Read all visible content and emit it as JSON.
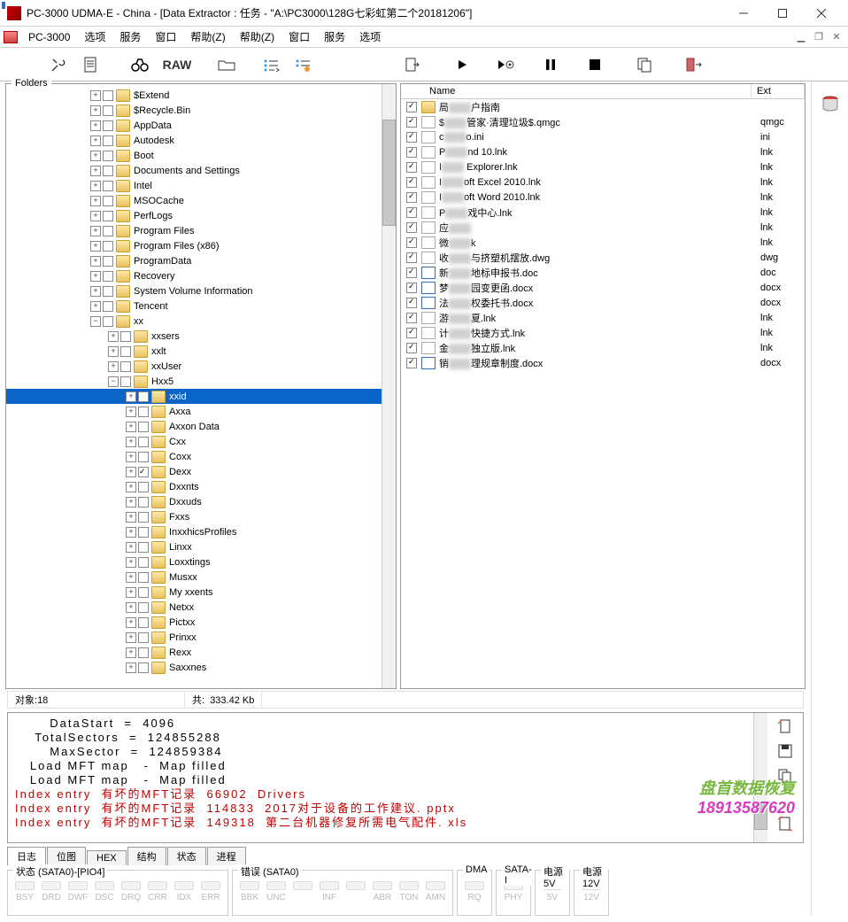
{
  "title": "PC-3000 UDMA-E - China - [Data Extractor : 任务 - \"A:\\PC3000\\128G七彩虹第二个20181206\"]",
  "app_name": "PC-3000",
  "menus": [
    "选项",
    "服务",
    "窗口",
    "帮助(Z)"
  ],
  "raw_label": "RAW",
  "folders_label": "Folders",
  "file_cols": {
    "name": "Name",
    "ext": "Ext"
  },
  "tree": [
    {
      "ind": 95,
      "exp": "+",
      "chk": false,
      "label": "$Extend"
    },
    {
      "ind": 95,
      "exp": "+",
      "chk": false,
      "label": "$Recycle.Bin"
    },
    {
      "ind": 95,
      "exp": "+",
      "chk": false,
      "label": "AppData"
    },
    {
      "ind": 95,
      "exp": "+",
      "chk": false,
      "label": "Autodesk"
    },
    {
      "ind": 95,
      "exp": "+",
      "chk": false,
      "label": "Boot"
    },
    {
      "ind": 95,
      "exp": "+",
      "chk": false,
      "label": "Documents and Settings"
    },
    {
      "ind": 95,
      "exp": "+",
      "chk": false,
      "label": "Intel"
    },
    {
      "ind": 95,
      "exp": "+",
      "chk": false,
      "label": "MSOCache"
    },
    {
      "ind": 95,
      "exp": "+",
      "chk": false,
      "label": "PerfLogs"
    },
    {
      "ind": 95,
      "exp": "+",
      "chk": false,
      "label": "Program Files"
    },
    {
      "ind": 95,
      "exp": "+",
      "chk": false,
      "label": "Program Files (x86)"
    },
    {
      "ind": 95,
      "exp": "+",
      "chk": false,
      "label": "ProgramData"
    },
    {
      "ind": 95,
      "exp": "+",
      "chk": false,
      "label": "Recovery"
    },
    {
      "ind": 95,
      "exp": "+",
      "chk": false,
      "label": "System Volume Information"
    },
    {
      "ind": 95,
      "exp": "+",
      "chk": false,
      "label": "Tencent"
    },
    {
      "ind": 95,
      "exp": "-",
      "chk": false,
      "label": "",
      "blur": 15
    },
    {
      "ind": 115,
      "exp": "+",
      "chk": false,
      "label": "sers",
      "blur": 20
    },
    {
      "ind": 115,
      "exp": "+",
      "chk": false,
      "label": "lt",
      "blur": 30
    },
    {
      "ind": 115,
      "exp": "+",
      "chk": false,
      "label": "User",
      "blur": 25
    },
    {
      "ind": 115,
      "exp": "-",
      "chk": false,
      "label": "5",
      "pre": "H",
      "blur": 30
    },
    {
      "ind": 135,
      "exp": "+",
      "chk": false,
      "label": "id",
      "blur": 35,
      "sel": true
    },
    {
      "ind": 135,
      "exp": "+",
      "chk": false,
      "label": "a",
      "pre": "A",
      "blur": 30
    },
    {
      "ind": 135,
      "exp": "+",
      "chk": false,
      "label": "on Data",
      "pre": "A",
      "blur": 25
    },
    {
      "ind": 135,
      "exp": "+",
      "chk": false,
      "label": "",
      "pre": "C",
      "blur": 35
    },
    {
      "ind": 135,
      "exp": "+",
      "chk": false,
      "label": "",
      "pre": "Co",
      "blur": 30
    },
    {
      "ind": 135,
      "exp": "+",
      "chk": true,
      "label": "",
      "pre": "De",
      "blur": 30
    },
    {
      "ind": 135,
      "exp": "+",
      "chk": false,
      "label": "nts",
      "pre": "D",
      "blur": 30
    },
    {
      "ind": 135,
      "exp": "+",
      "chk": false,
      "label": "uds",
      "pre": "D",
      "blur": 30
    },
    {
      "ind": 135,
      "exp": "+",
      "chk": false,
      "label": "s",
      "pre": "F",
      "blur": 30
    },
    {
      "ind": 135,
      "exp": "+",
      "chk": false,
      "label": "hicsProfiles",
      "pre": "In",
      "blur": 20
    },
    {
      "ind": 135,
      "exp": "+",
      "chk": false,
      "label": "",
      "pre": "Lin",
      "blur": 30
    },
    {
      "ind": 135,
      "exp": "+",
      "chk": false,
      "label": "tings",
      "pre": "Lo",
      "blur": 25
    },
    {
      "ind": 135,
      "exp": "+",
      "chk": false,
      "label": "",
      "pre": "Mus",
      "blur": 30
    },
    {
      "ind": 135,
      "exp": "+",
      "chk": false,
      "label": "ents",
      "pre": "My ",
      "blur": 25
    },
    {
      "ind": 135,
      "exp": "+",
      "chk": false,
      "label": "",
      "pre": "Net",
      "blur": 30
    },
    {
      "ind": 135,
      "exp": "+",
      "chk": false,
      "label": "",
      "pre": "Pict",
      "blur": 30
    },
    {
      "ind": 135,
      "exp": "+",
      "chk": false,
      "label": "",
      "pre": "Prin",
      "blur": 28
    },
    {
      "ind": 135,
      "exp": "+",
      "chk": false,
      "label": "",
      "pre": "Re",
      "blur": 30
    },
    {
      "ind": 135,
      "exp": "+",
      "chk": false,
      "label": "nes",
      "pre": "Sa",
      "blur": 30
    }
  ],
  "files": [
    {
      "chk": true,
      "icon": "folder",
      "pre": "局",
      "blur": 25,
      "suf": "户指南",
      "ext": ""
    },
    {
      "chk": true,
      "icon": "file",
      "pre": "$",
      "blur": 25,
      "suf": "管家·清理垃圾$.qmgc",
      "ext": "qmgc"
    },
    {
      "chk": true,
      "icon": "file",
      "pre": "c",
      "blur": 25,
      "suf": "o.ini",
      "ext": "ini"
    },
    {
      "chk": true,
      "icon": "file",
      "pre": "P",
      "blur": 25,
      "suf": "nd 10.lnk",
      "ext": "lnk"
    },
    {
      "chk": true,
      "icon": "file",
      "pre": "I",
      "blur": 25,
      "suf": " Explorer.lnk",
      "ext": "lnk"
    },
    {
      "chk": true,
      "icon": "file",
      "pre": "I",
      "blur": 25,
      "suf": "oft Excel 2010.lnk",
      "ext": "lnk"
    },
    {
      "chk": true,
      "icon": "file",
      "pre": "I",
      "blur": 25,
      "suf": "oft Word 2010.lnk",
      "ext": "lnk"
    },
    {
      "chk": true,
      "icon": "file",
      "pre": "P",
      "blur": 25,
      "suf": "戏中心.lnk",
      "ext": "lnk"
    },
    {
      "chk": true,
      "icon": "file",
      "pre": "应",
      "blur": 25,
      "suf": "",
      "ext": "lnk"
    },
    {
      "chk": true,
      "icon": "file",
      "pre": "微",
      "blur": 25,
      "suf": "k",
      "ext": "lnk"
    },
    {
      "chk": true,
      "icon": "file",
      "pre": "收",
      "blur": 25,
      "suf": "与挤塑机摆放.dwg",
      "ext": "dwg"
    },
    {
      "chk": true,
      "icon": "doc",
      "pre": "新",
      "blur": 25,
      "suf": "地标申报书.doc",
      "ext": "doc"
    },
    {
      "chk": true,
      "icon": "doc",
      "pre": "梦",
      "blur": 25,
      "suf": "园变更函.docx",
      "ext": "docx"
    },
    {
      "chk": true,
      "icon": "doc",
      "pre": "法",
      "blur": 25,
      "suf": "权委托书.docx",
      "ext": "docx"
    },
    {
      "chk": true,
      "icon": "file",
      "pre": "游",
      "blur": 25,
      "suf": "夏.lnk",
      "ext": "lnk"
    },
    {
      "chk": true,
      "icon": "file",
      "pre": "计",
      "blur": 25,
      "suf": "快捷方式.lnk",
      "ext": "lnk"
    },
    {
      "chk": true,
      "icon": "file",
      "pre": "金",
      "blur": 25,
      "suf": "独立版.lnk",
      "ext": "lnk"
    },
    {
      "chk": true,
      "icon": "doc",
      "pre": "销",
      "blur": 25,
      "suf": "理规章制度.docx",
      "ext": "docx"
    }
  ],
  "status": {
    "objects_label": "对象:",
    "objects": "18",
    "total_label": "共:",
    "total": "333.42 Kb"
  },
  "log_lines": [
    {
      "t": "       DataStart  =  4096"
    },
    {
      "t": "    TotalSectors  =  124855288"
    },
    {
      "t": "       MaxSector  =  124859384"
    },
    {
      "t": "   Load MFT map   -  Map filled"
    },
    {
      "t": "   Load MFT map   -  Map filled"
    },
    {
      "t": "Index entry  有坏的MFT记录  66902  Drivers",
      "cls": "red"
    },
    {
      "t": "Index entry  有坏的MFT记录  114833  2017对于设备的工作建议. pptx",
      "cls": "red"
    },
    {
      "t": "Index entry  有坏的MFT记录  149318  第二台机器修复所需电气配件. xls",
      "cls": "red"
    }
  ],
  "watermark": {
    "line1": "盘首数据恢复",
    "line2": "18913587620"
  },
  "tabs": [
    "日志",
    "位图",
    "HEX",
    "结构",
    "状态",
    "进程"
  ],
  "active_tab": 0,
  "led_groups": [
    {
      "title": "状态 (SATA0)-[PIO4]",
      "leds": [
        "BSY",
        "DRD",
        "DWF",
        "DSC",
        "DRQ",
        "CRR",
        "IDX",
        "ERR"
      ]
    },
    {
      "title": "错误 (SATA0)",
      "leds": [
        "BBK",
        "UNC",
        "",
        "INF",
        "",
        "ABR",
        "TON",
        "AMN"
      ]
    },
    {
      "title": "DMA",
      "leds": [
        "RQ"
      ]
    },
    {
      "title": "SATA-I",
      "leds": [
        "PHY"
      ]
    },
    {
      "title": "电源 5V",
      "leds": [
        "5V"
      ]
    },
    {
      "title": "电源 12V",
      "leds": [
        "12V"
      ]
    }
  ]
}
